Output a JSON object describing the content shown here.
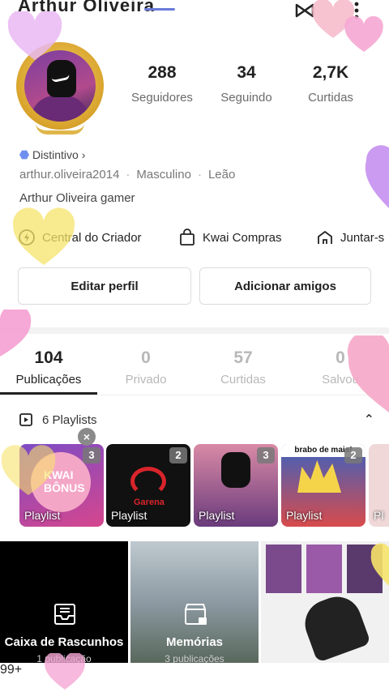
{
  "header": {
    "title": "Arthur Oliveira",
    "icons": {
      "share": "share-icon",
      "more": "more-vertical-icon"
    }
  },
  "profile": {
    "stats": [
      {
        "value": "288",
        "label": "Seguidores"
      },
      {
        "value": "34",
        "label": "Seguindo"
      },
      {
        "value": "2,7K",
        "label": "Curtidas"
      }
    ],
    "badge_label": "Distintivo",
    "username": "arthur.oliveira2014",
    "gender": "Masculino",
    "sign": "Leão",
    "bio": "Arthur Oliveira gamer"
  },
  "shortcuts": [
    {
      "label": "Central do Criador",
      "icon": "lightning-icon"
    },
    {
      "label": "Kwai Compras",
      "icon": "shopping-bag-icon"
    },
    {
      "label": "Juntar-s",
      "icon": "house-icon"
    }
  ],
  "buttons": {
    "edit": "Editar perfil",
    "add_friends": "Adicionar amigos"
  },
  "tabs": [
    {
      "count": "104",
      "label": "Publicações",
      "active": true
    },
    {
      "count": "0",
      "label": "Privado",
      "active": false
    },
    {
      "count": "57",
      "label": "Curtidas",
      "active": false
    },
    {
      "count": "0",
      "label": "Salvou",
      "active": false
    }
  ],
  "playlists": {
    "header": "6 Playlists",
    "items": [
      {
        "label": "Playlist",
        "count": "3",
        "overlay": "KWAI BÔNUS"
      },
      {
        "label": "Playlist",
        "count": "2",
        "overlay": "Garena"
      },
      {
        "label": "Playlist",
        "count": "3",
        "overlay": ""
      },
      {
        "label": "Playlist",
        "count": "2",
        "overlay": "brabo de mais!"
      },
      {
        "label": "Pl",
        "count": "",
        "overlay": ""
      }
    ]
  },
  "grid": [
    {
      "title": "Caixa de Rascunhos",
      "subtitle": "1 publicação"
    },
    {
      "title": "Memórias",
      "subtitle": "3 publicações"
    },
    {
      "title": "",
      "subtitle": ""
    }
  ],
  "nav": {
    "items": [
      "home-icon",
      "discover-icon",
      "add-icon",
      "bell-icon",
      "profile-icon"
    ],
    "notification_badge": "99+"
  },
  "colors": {
    "accent_red": "#e8213a",
    "badge_blue": "#6e8ff0",
    "gold": "#d8a32b"
  }
}
